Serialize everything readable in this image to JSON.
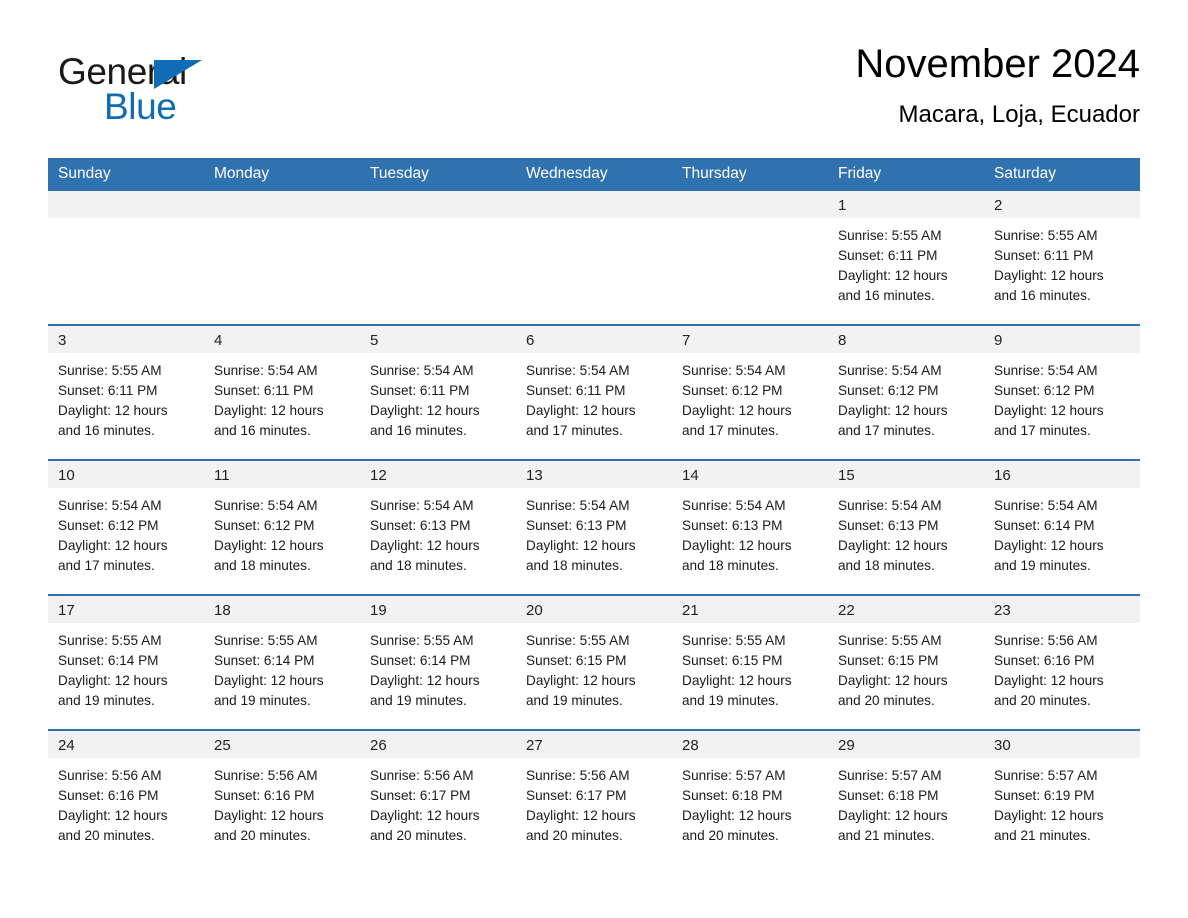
{
  "brand": {
    "name_part1": "General",
    "name_part2": "Blue",
    "triangle_color": "#0f6cb5"
  },
  "header": {
    "title": "November 2024",
    "subtitle": "Macara, Loja, Ecuador"
  },
  "colors": {
    "header_blue": "#3071b0",
    "daynum_band": "#f2f2f2",
    "text": "#1a1a1a"
  },
  "weekday_headers": [
    "Sunday",
    "Monday",
    "Tuesday",
    "Wednesday",
    "Thursday",
    "Friday",
    "Saturday"
  ],
  "weeks": [
    [
      {
        "day": "",
        "empty": true
      },
      {
        "day": "",
        "empty": true
      },
      {
        "day": "",
        "empty": true
      },
      {
        "day": "",
        "empty": true
      },
      {
        "day": "",
        "empty": true
      },
      {
        "day": "1",
        "sunrise": "Sunrise: 5:55 AM",
        "sunset": "Sunset: 6:11 PM",
        "daylight1": "Daylight: 12 hours",
        "daylight2": "and 16 minutes."
      },
      {
        "day": "2",
        "sunrise": "Sunrise: 5:55 AM",
        "sunset": "Sunset: 6:11 PM",
        "daylight1": "Daylight: 12 hours",
        "daylight2": "and 16 minutes."
      }
    ],
    [
      {
        "day": "3",
        "sunrise": "Sunrise: 5:55 AM",
        "sunset": "Sunset: 6:11 PM",
        "daylight1": "Daylight: 12 hours",
        "daylight2": "and 16 minutes."
      },
      {
        "day": "4",
        "sunrise": "Sunrise: 5:54 AM",
        "sunset": "Sunset: 6:11 PM",
        "daylight1": "Daylight: 12 hours",
        "daylight2": "and 16 minutes."
      },
      {
        "day": "5",
        "sunrise": "Sunrise: 5:54 AM",
        "sunset": "Sunset: 6:11 PM",
        "daylight1": "Daylight: 12 hours",
        "daylight2": "and 16 minutes."
      },
      {
        "day": "6",
        "sunrise": "Sunrise: 5:54 AM",
        "sunset": "Sunset: 6:11 PM",
        "daylight1": "Daylight: 12 hours",
        "daylight2": "and 17 minutes."
      },
      {
        "day": "7",
        "sunrise": "Sunrise: 5:54 AM",
        "sunset": "Sunset: 6:12 PM",
        "daylight1": "Daylight: 12 hours",
        "daylight2": "and 17 minutes."
      },
      {
        "day": "8",
        "sunrise": "Sunrise: 5:54 AM",
        "sunset": "Sunset: 6:12 PM",
        "daylight1": "Daylight: 12 hours",
        "daylight2": "and 17 minutes."
      },
      {
        "day": "9",
        "sunrise": "Sunrise: 5:54 AM",
        "sunset": "Sunset: 6:12 PM",
        "daylight1": "Daylight: 12 hours",
        "daylight2": "and 17 minutes."
      }
    ],
    [
      {
        "day": "10",
        "sunrise": "Sunrise: 5:54 AM",
        "sunset": "Sunset: 6:12 PM",
        "daylight1": "Daylight: 12 hours",
        "daylight2": "and 17 minutes."
      },
      {
        "day": "11",
        "sunrise": "Sunrise: 5:54 AM",
        "sunset": "Sunset: 6:12 PM",
        "daylight1": "Daylight: 12 hours",
        "daylight2": "and 18 minutes."
      },
      {
        "day": "12",
        "sunrise": "Sunrise: 5:54 AM",
        "sunset": "Sunset: 6:13 PM",
        "daylight1": "Daylight: 12 hours",
        "daylight2": "and 18 minutes."
      },
      {
        "day": "13",
        "sunrise": "Sunrise: 5:54 AM",
        "sunset": "Sunset: 6:13 PM",
        "daylight1": "Daylight: 12 hours",
        "daylight2": "and 18 minutes."
      },
      {
        "day": "14",
        "sunrise": "Sunrise: 5:54 AM",
        "sunset": "Sunset: 6:13 PM",
        "daylight1": "Daylight: 12 hours",
        "daylight2": "and 18 minutes."
      },
      {
        "day": "15",
        "sunrise": "Sunrise: 5:54 AM",
        "sunset": "Sunset: 6:13 PM",
        "daylight1": "Daylight: 12 hours",
        "daylight2": "and 18 minutes."
      },
      {
        "day": "16",
        "sunrise": "Sunrise: 5:54 AM",
        "sunset": "Sunset: 6:14 PM",
        "daylight1": "Daylight: 12 hours",
        "daylight2": "and 19 minutes."
      }
    ],
    [
      {
        "day": "17",
        "sunrise": "Sunrise: 5:55 AM",
        "sunset": "Sunset: 6:14 PM",
        "daylight1": "Daylight: 12 hours",
        "daylight2": "and 19 minutes."
      },
      {
        "day": "18",
        "sunrise": "Sunrise: 5:55 AM",
        "sunset": "Sunset: 6:14 PM",
        "daylight1": "Daylight: 12 hours",
        "daylight2": "and 19 minutes."
      },
      {
        "day": "19",
        "sunrise": "Sunrise: 5:55 AM",
        "sunset": "Sunset: 6:14 PM",
        "daylight1": "Daylight: 12 hours",
        "daylight2": "and 19 minutes."
      },
      {
        "day": "20",
        "sunrise": "Sunrise: 5:55 AM",
        "sunset": "Sunset: 6:15 PM",
        "daylight1": "Daylight: 12 hours",
        "daylight2": "and 19 minutes."
      },
      {
        "day": "21",
        "sunrise": "Sunrise: 5:55 AM",
        "sunset": "Sunset: 6:15 PM",
        "daylight1": "Daylight: 12 hours",
        "daylight2": "and 19 minutes."
      },
      {
        "day": "22",
        "sunrise": "Sunrise: 5:55 AM",
        "sunset": "Sunset: 6:15 PM",
        "daylight1": "Daylight: 12 hours",
        "daylight2": "and 20 minutes."
      },
      {
        "day": "23",
        "sunrise": "Sunrise: 5:56 AM",
        "sunset": "Sunset: 6:16 PM",
        "daylight1": "Daylight: 12 hours",
        "daylight2": "and 20 minutes."
      }
    ],
    [
      {
        "day": "24",
        "sunrise": "Sunrise: 5:56 AM",
        "sunset": "Sunset: 6:16 PM",
        "daylight1": "Daylight: 12 hours",
        "daylight2": "and 20 minutes."
      },
      {
        "day": "25",
        "sunrise": "Sunrise: 5:56 AM",
        "sunset": "Sunset: 6:16 PM",
        "daylight1": "Daylight: 12 hours",
        "daylight2": "and 20 minutes."
      },
      {
        "day": "26",
        "sunrise": "Sunrise: 5:56 AM",
        "sunset": "Sunset: 6:17 PM",
        "daylight1": "Daylight: 12 hours",
        "daylight2": "and 20 minutes."
      },
      {
        "day": "27",
        "sunrise": "Sunrise: 5:56 AM",
        "sunset": "Sunset: 6:17 PM",
        "daylight1": "Daylight: 12 hours",
        "daylight2": "and 20 minutes."
      },
      {
        "day": "28",
        "sunrise": "Sunrise: 5:57 AM",
        "sunset": "Sunset: 6:18 PM",
        "daylight1": "Daylight: 12 hours",
        "daylight2": "and 20 minutes."
      },
      {
        "day": "29",
        "sunrise": "Sunrise: 5:57 AM",
        "sunset": "Sunset: 6:18 PM",
        "daylight1": "Daylight: 12 hours",
        "daylight2": "and 21 minutes."
      },
      {
        "day": "30",
        "sunrise": "Sunrise: 5:57 AM",
        "sunset": "Sunset: 6:19 PM",
        "daylight1": "Daylight: 12 hours",
        "daylight2": "and 21 minutes."
      }
    ]
  ]
}
